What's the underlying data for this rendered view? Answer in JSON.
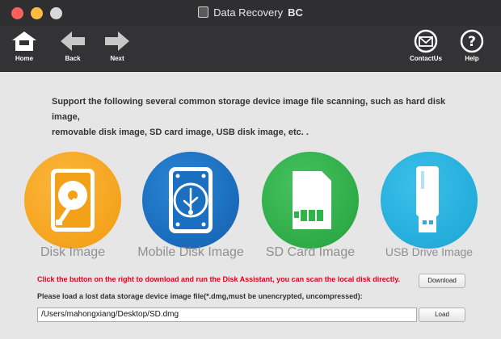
{
  "window": {
    "title": "Data Recovery",
    "title_suffix": "BC"
  },
  "toolbar": {
    "home_label": "Home",
    "back_label": "Back",
    "next_label": "Next",
    "contact_label": "ContactUs",
    "help_label": "Help"
  },
  "main": {
    "intro_line1": "Support the following several common storage device image file scanning, such as hard disk image,",
    "intro_line2": "removable disk image, SD card image, USB disk image, etc. .",
    "devices": [
      {
        "label": "Disk Image",
        "color": "#f7a41c",
        "icon": "hard-disk-icon"
      },
      {
        "label": "Mobile Disk Image",
        "color": "#1a6fc0",
        "icon": "mobile-disk-icon"
      },
      {
        "label": "SD Card Image",
        "color": "#2fb34a",
        "icon": "sd-card-icon"
      },
      {
        "label": "USB Drive Image",
        "color": "#23b0de",
        "icon": "usb-drive-icon"
      }
    ],
    "download_hint": "Click the button on the right to download and run the Disk Assistant, you can scan the local disk directly.",
    "download_button": "Download",
    "load_hint": "Please load a lost data storage device image file(*.dmg,must be unencrypted, uncompressed):",
    "path_value": "/Users/mahongxiang/Desktop/SD.dmg",
    "load_button": "Load"
  },
  "colors": {
    "titlebar": "#2f2f31",
    "toolbar": "#333335",
    "warning_text": "#e0001b"
  }
}
